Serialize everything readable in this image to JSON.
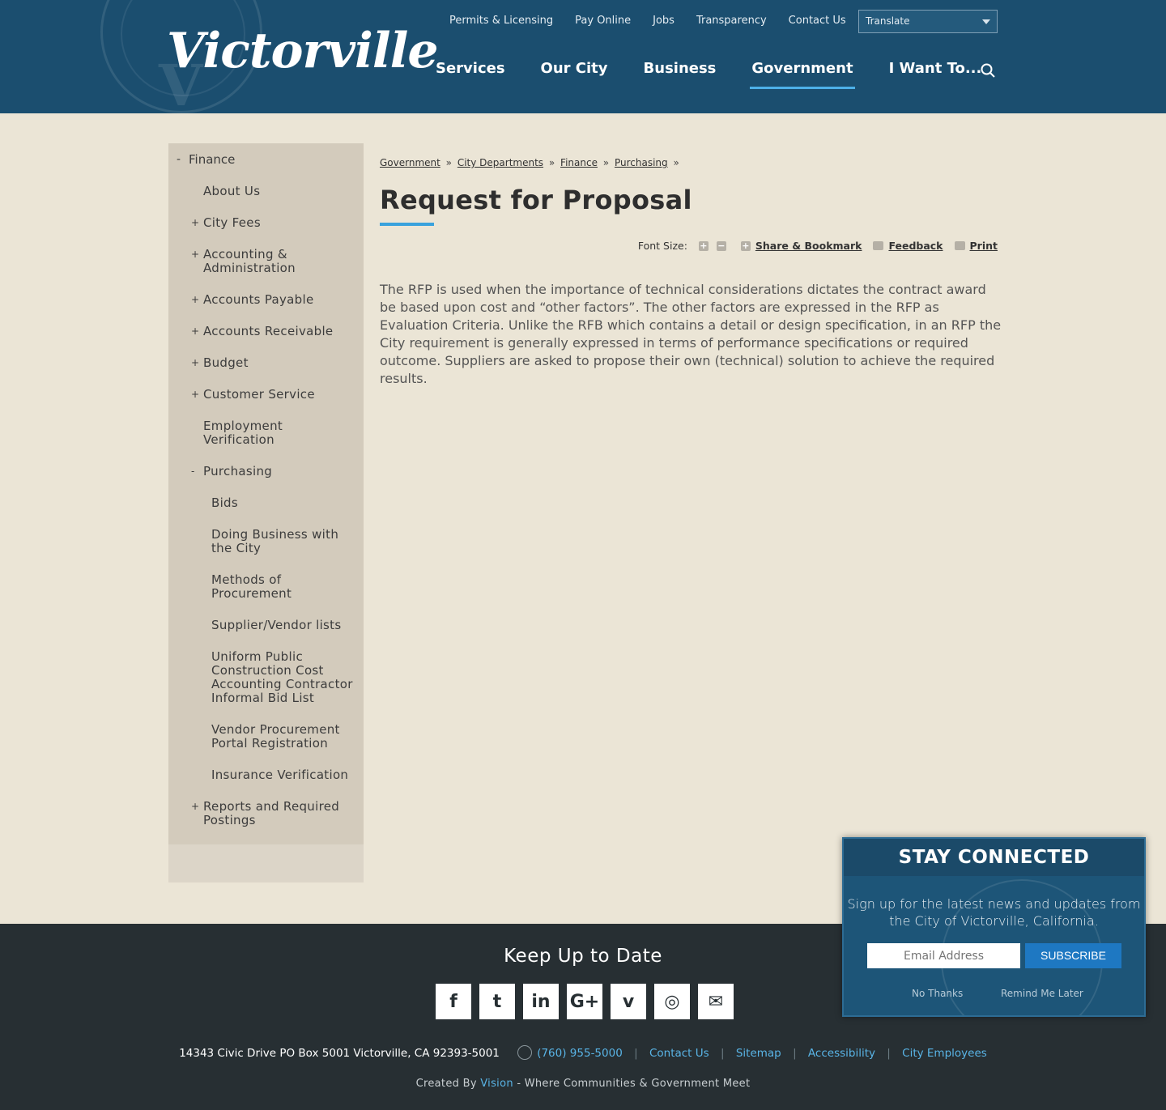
{
  "header": {
    "logo_text": "Victorville",
    "util_nav": [
      "Permits & Licensing",
      "Pay Online",
      "Jobs",
      "Transparency",
      "Contact Us"
    ],
    "translate_label": "Translate",
    "main_nav": [
      {
        "label": "Services",
        "active": false
      },
      {
        "label": "Our City",
        "active": false
      },
      {
        "label": "Business",
        "active": false
      },
      {
        "label": "Government",
        "active": true
      },
      {
        "label": "I Want To...",
        "active": false
      }
    ]
  },
  "sidebar": {
    "heading": "Finance",
    "heading_sign": "-",
    "items": [
      {
        "label": "About Us",
        "sign": "",
        "level": 1
      },
      {
        "label": "City Fees",
        "sign": "+",
        "level": 1
      },
      {
        "label": "Accounting & Administration",
        "sign": "+",
        "level": 1
      },
      {
        "label": "Accounts Payable",
        "sign": "+",
        "level": 1
      },
      {
        "label": "Accounts Receivable",
        "sign": "+",
        "level": 1
      },
      {
        "label": "Budget",
        "sign": "+",
        "level": 1
      },
      {
        "label": "Customer Service",
        "sign": "+",
        "level": 1
      },
      {
        "label": "Employment Verification",
        "sign": "",
        "level": 1
      },
      {
        "label": "Purchasing",
        "sign": "-",
        "level": 1
      },
      {
        "label": "Bids",
        "sign": "",
        "level": 2
      },
      {
        "label": "Doing Business with the City",
        "sign": "",
        "level": 2
      },
      {
        "label": "Methods of Procurement",
        "sign": "",
        "level": 2
      },
      {
        "label": "Supplier/Vendor lists",
        "sign": "",
        "level": 2
      },
      {
        "label": "Uniform Public Construction Cost Accounting Contractor Informal Bid List",
        "sign": "",
        "level": 2
      },
      {
        "label": "Vendor Procurement Portal Registration",
        "sign": "",
        "level": 2
      },
      {
        "label": "Insurance Verification",
        "sign": "",
        "level": 2
      },
      {
        "label": "Reports and Required Postings",
        "sign": "+",
        "level": 1
      }
    ]
  },
  "breadcrumb": [
    "Government",
    "City Departments",
    "Finance",
    "Purchasing"
  ],
  "breadcrumb_sep": "»",
  "page": {
    "title": "Request for Proposal",
    "font_size_label": "Font Size:",
    "share_label": "Share & Bookmark",
    "feedback_label": "Feedback",
    "print_label": "Print",
    "body": "The RFP is used when the importance of technical considerations dictates the contract award be based upon cost and “other factors”. The other factors are expressed in the RFP as Evaluation Criteria. Unlike the RFB which contains a detail or design specification, in an RFP the City requirement is generally expressed in terms of performance specifications or required outcome. Suppliers are asked to propose their own (technical) solution to achieve the required results."
  },
  "footer": {
    "title": "Keep Up to Date",
    "social": [
      {
        "icon": "facebook-icon",
        "glyph": "f"
      },
      {
        "icon": "twitter-icon",
        "glyph": "t"
      },
      {
        "icon": "linkedin-icon",
        "glyph": "in"
      },
      {
        "icon": "google-plus-icon",
        "glyph": "G+"
      },
      {
        "icon": "vimeo-icon",
        "glyph": "v"
      },
      {
        "icon": "instagram-icon",
        "glyph": "◎"
      },
      {
        "icon": "email-icon",
        "glyph": "✉"
      }
    ],
    "address": "14343 Civic Drive PO Box 5001 Victorville, CA 92393-5001",
    "phone": "(760) 955-5000",
    "links": [
      "Contact Us",
      "Sitemap",
      "Accessibility",
      "City Employees"
    ],
    "credit_prefix": "Created By",
    "credit_link": "Vision",
    "credit_suffix": "- Where Communities & Government Meet"
  },
  "popup": {
    "title": "STAY CONNECTED",
    "message": "Sign up for the latest news and updates from the City of Victorville, California.",
    "email_placeholder": "Email Address",
    "subscribe_label": "SUBSCRIBE",
    "no_thanks": "No Thanks",
    "remind_later": "Remind Me Later"
  },
  "colors": {
    "header_bg": "#1b4e6f",
    "accent": "#39a2dd",
    "page_bg": "#ebe5d6",
    "footer_bg": "#272f33",
    "link_blue": "#59b4e6"
  }
}
